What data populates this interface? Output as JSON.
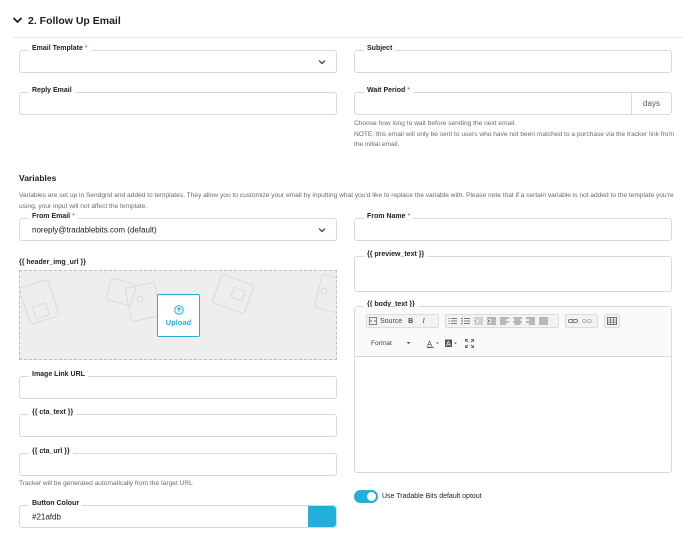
{
  "section": {
    "title": "2. Follow Up Email"
  },
  "email_template": {
    "label": "Email Template",
    "value": ""
  },
  "subject": {
    "label": "Subject",
    "value": ""
  },
  "reply_email": {
    "label": "Reply Email",
    "value": ""
  },
  "wait_period": {
    "label": "Wait Period",
    "value": "",
    "suffix": "days",
    "help_line1": "Choose how long to wait before sending the next email.",
    "help_line2": "NOTE: this email will only be sent to users who have not been matched to a purchase via the tracker link from the initial email."
  },
  "variables": {
    "heading": "Variables",
    "description": "Variables are set up in Sendgrid and added to templates. They allow you to customize your email by inputting what you'd like to replace the variable with. Please note that if a certain variable is not added to the template you're using, your input will not affect the template."
  },
  "from_email": {
    "label": "From Email",
    "value": "noreply@tradablebits.com (default)"
  },
  "from_name": {
    "label": "From Name",
    "value": ""
  },
  "header_img": {
    "label": "{{ header_img_url }}",
    "upload_label": "Upload"
  },
  "preview_text": {
    "label": "{{ preview_text }}",
    "value": ""
  },
  "body_text": {
    "label": "{{ body_text }}",
    "toolbar": {
      "source": "Source",
      "bold": "B",
      "italic": "I",
      "format": "Format"
    }
  },
  "image_link_url": {
    "label": "Image Link URL",
    "value": ""
  },
  "cta_text": {
    "label": "{{ cta_text }}",
    "value": ""
  },
  "cta_url": {
    "label": "{{ cta_url }}",
    "value": "",
    "help": "Tracker will be generated automatically from the target URL"
  },
  "optout": {
    "label": "Use Tradable Bits default optout",
    "enabled": true
  },
  "button_colour": {
    "label": "Button Colour",
    "value": "#21afdb"
  },
  "colors": {
    "accent": "#21afdb",
    "required": "#e0245e"
  }
}
